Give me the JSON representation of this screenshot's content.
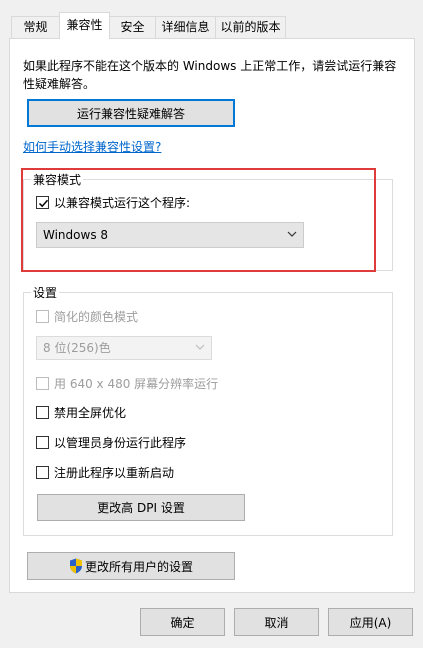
{
  "tabs": [
    "常规",
    "兼容性",
    "安全",
    "详细信息",
    "以前的版本"
  ],
  "intro_text": "如果此程序不能在这个版本的 Windows 上正常工作，请尝试运行兼容性疑难解答。",
  "troubleshoot_button": "运行兼容性疑难解答",
  "manual_link": "如何手动选择兼容性设置?",
  "compat_mode": {
    "legend": "兼容模式",
    "checkbox_label": "以兼容模式运行这个程序:",
    "checked": true,
    "os_select": "Windows 8"
  },
  "settings": {
    "legend": "设置",
    "reduced_color": "简化的颜色模式",
    "color_select": "8 位(256)色",
    "res_640": "用 640 x 480 屏幕分辨率运行",
    "disable_fullscreen": "禁用全屏优化",
    "run_as_admin": "以管理员身份运行此程序",
    "register_restart": "注册此程序以重新启动",
    "dpi_button": "更改高 DPI 设置"
  },
  "all_users_button": "更改所有用户的设置",
  "footer": {
    "ok": "确定",
    "cancel": "取消",
    "apply": "应用(A)"
  }
}
